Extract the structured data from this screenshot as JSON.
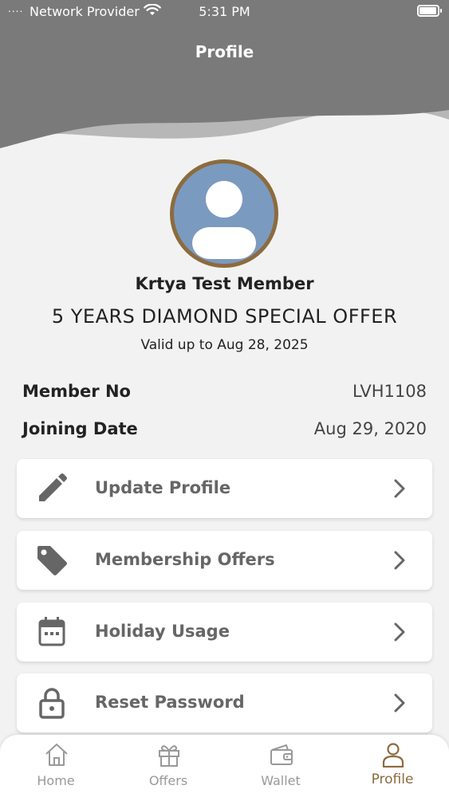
{
  "status_bar": {
    "signal": "....",
    "carrier": "Network Provider",
    "time": "5:31 PM",
    "battery_level": 0.95
  },
  "header": {
    "title": "Profile"
  },
  "profile": {
    "name": "Krtya Test Member",
    "plan": "5 YEARS DIAMOND SPECIAL OFFER",
    "validity": "Valid up to Aug 28, 2025"
  },
  "details": [
    {
      "label": "Member No",
      "value": "LVH1108"
    },
    {
      "label": "Joining Date",
      "value": "Aug 29, 2020"
    }
  ],
  "menu": [
    {
      "label": "Update Profile",
      "icon": "pencil-icon"
    },
    {
      "label": "Membership Offers",
      "icon": "tag-icon"
    },
    {
      "label": "Holiday Usage",
      "icon": "calendar-icon"
    },
    {
      "label": "Reset Password",
      "icon": "lock-icon"
    }
  ],
  "tabs": [
    {
      "label": "Home",
      "icon": "home-icon"
    },
    {
      "label": "Offers",
      "icon": "gift-icon"
    },
    {
      "label": "Wallet",
      "icon": "wallet-icon"
    },
    {
      "label": "Profile",
      "icon": "person-icon",
      "active": true
    }
  ],
  "colors": {
    "header": "#7a7a7a",
    "accent": "#8c6b3d",
    "avatar_bg": "#7b9ac0",
    "background": "#f2f2f2"
  }
}
